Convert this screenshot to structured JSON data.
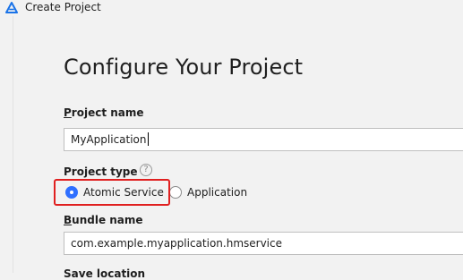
{
  "window": {
    "title": "Create Project",
    "logo_icon": "harmony-triangle-logo-icon",
    "brand_color": "#1a73e8"
  },
  "page": {
    "title": "Configure Your Project"
  },
  "project_name": {
    "label_mnemonic": "P",
    "label_rest": "roject name",
    "value": "MyApplication"
  },
  "project_type": {
    "label": "Project type",
    "help_icon": "question-icon",
    "help_glyph": "?",
    "options": [
      {
        "label": "Atomic Service",
        "selected": true
      },
      {
        "label": "Application",
        "selected": false
      }
    ],
    "highlight_color": "#e02020"
  },
  "bundle_name": {
    "label_mnemonic": "B",
    "label_rest": "undle name",
    "value": "com.example.myapplication.hmservice"
  },
  "next_field": {
    "label": "Save location"
  }
}
